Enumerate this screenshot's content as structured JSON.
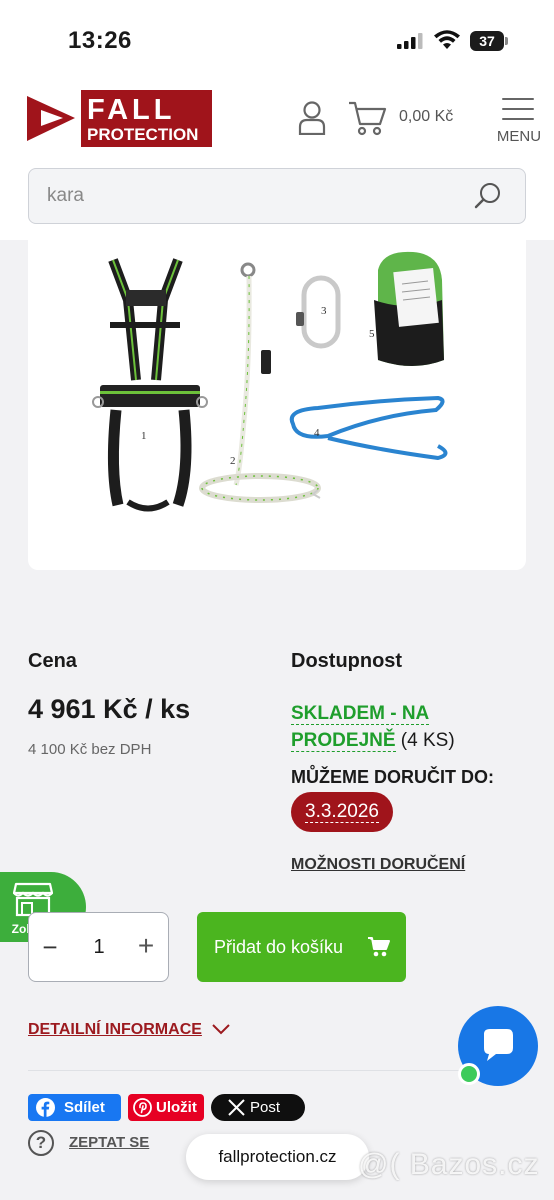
{
  "status": {
    "time": "13:26",
    "battery": "37"
  },
  "header": {
    "logo_line1": "FALL",
    "logo_line2": "PROTECTION",
    "cart_total": "0,00 Kč",
    "menu_label": "MENU"
  },
  "search": {
    "value": "kara"
  },
  "product_image": {
    "labels": [
      "1",
      "2",
      "3",
      "4",
      "5"
    ]
  },
  "price": {
    "heading": "Cena",
    "value": "4 961 Kč / ks",
    "net": "4 100 Kč bez DPH"
  },
  "availability": {
    "heading": "Dostupnost",
    "stock": "SKLADEM - NA PRODEJNĚ",
    "count": " (4 KS)",
    "delivery_heading": "MŮŽEME DORUČIT DO:",
    "delivery_date": "3.3.2026",
    "delivery_options": "MOŽNOSTI DORUČENÍ"
  },
  "store_button": {
    "label": "Zobrazit"
  },
  "quantity": {
    "minus": "−",
    "value": "1",
    "plus": "+"
  },
  "add_to_cart": {
    "label": "Přidat do košíku"
  },
  "details": {
    "label": "DETAILNÍ INFORMACE"
  },
  "share": {
    "facebook": "Sdílet",
    "pinterest": "Uložit",
    "x": "Post"
  },
  "ask": {
    "icon": "?",
    "label": "ZEPTAT SE"
  },
  "url_pill": "fallprotection.cz",
  "watermark": "@( Bazos.cz",
  "colors": {
    "brand_red": "#a0141b",
    "green_stock": "#1f9e2c",
    "add_to_cart_green": "#4bb51f",
    "chat_blue": "#1877e6"
  },
  "icons": [
    "signal-icon",
    "wifi-icon",
    "battery-icon",
    "user-icon",
    "cart-icon",
    "menu-icon",
    "search-icon",
    "shop-icon",
    "cart-small-icon",
    "chevron-down-icon",
    "chat-icon",
    "facebook-icon",
    "pinterest-icon",
    "x-icon",
    "question-icon"
  ]
}
